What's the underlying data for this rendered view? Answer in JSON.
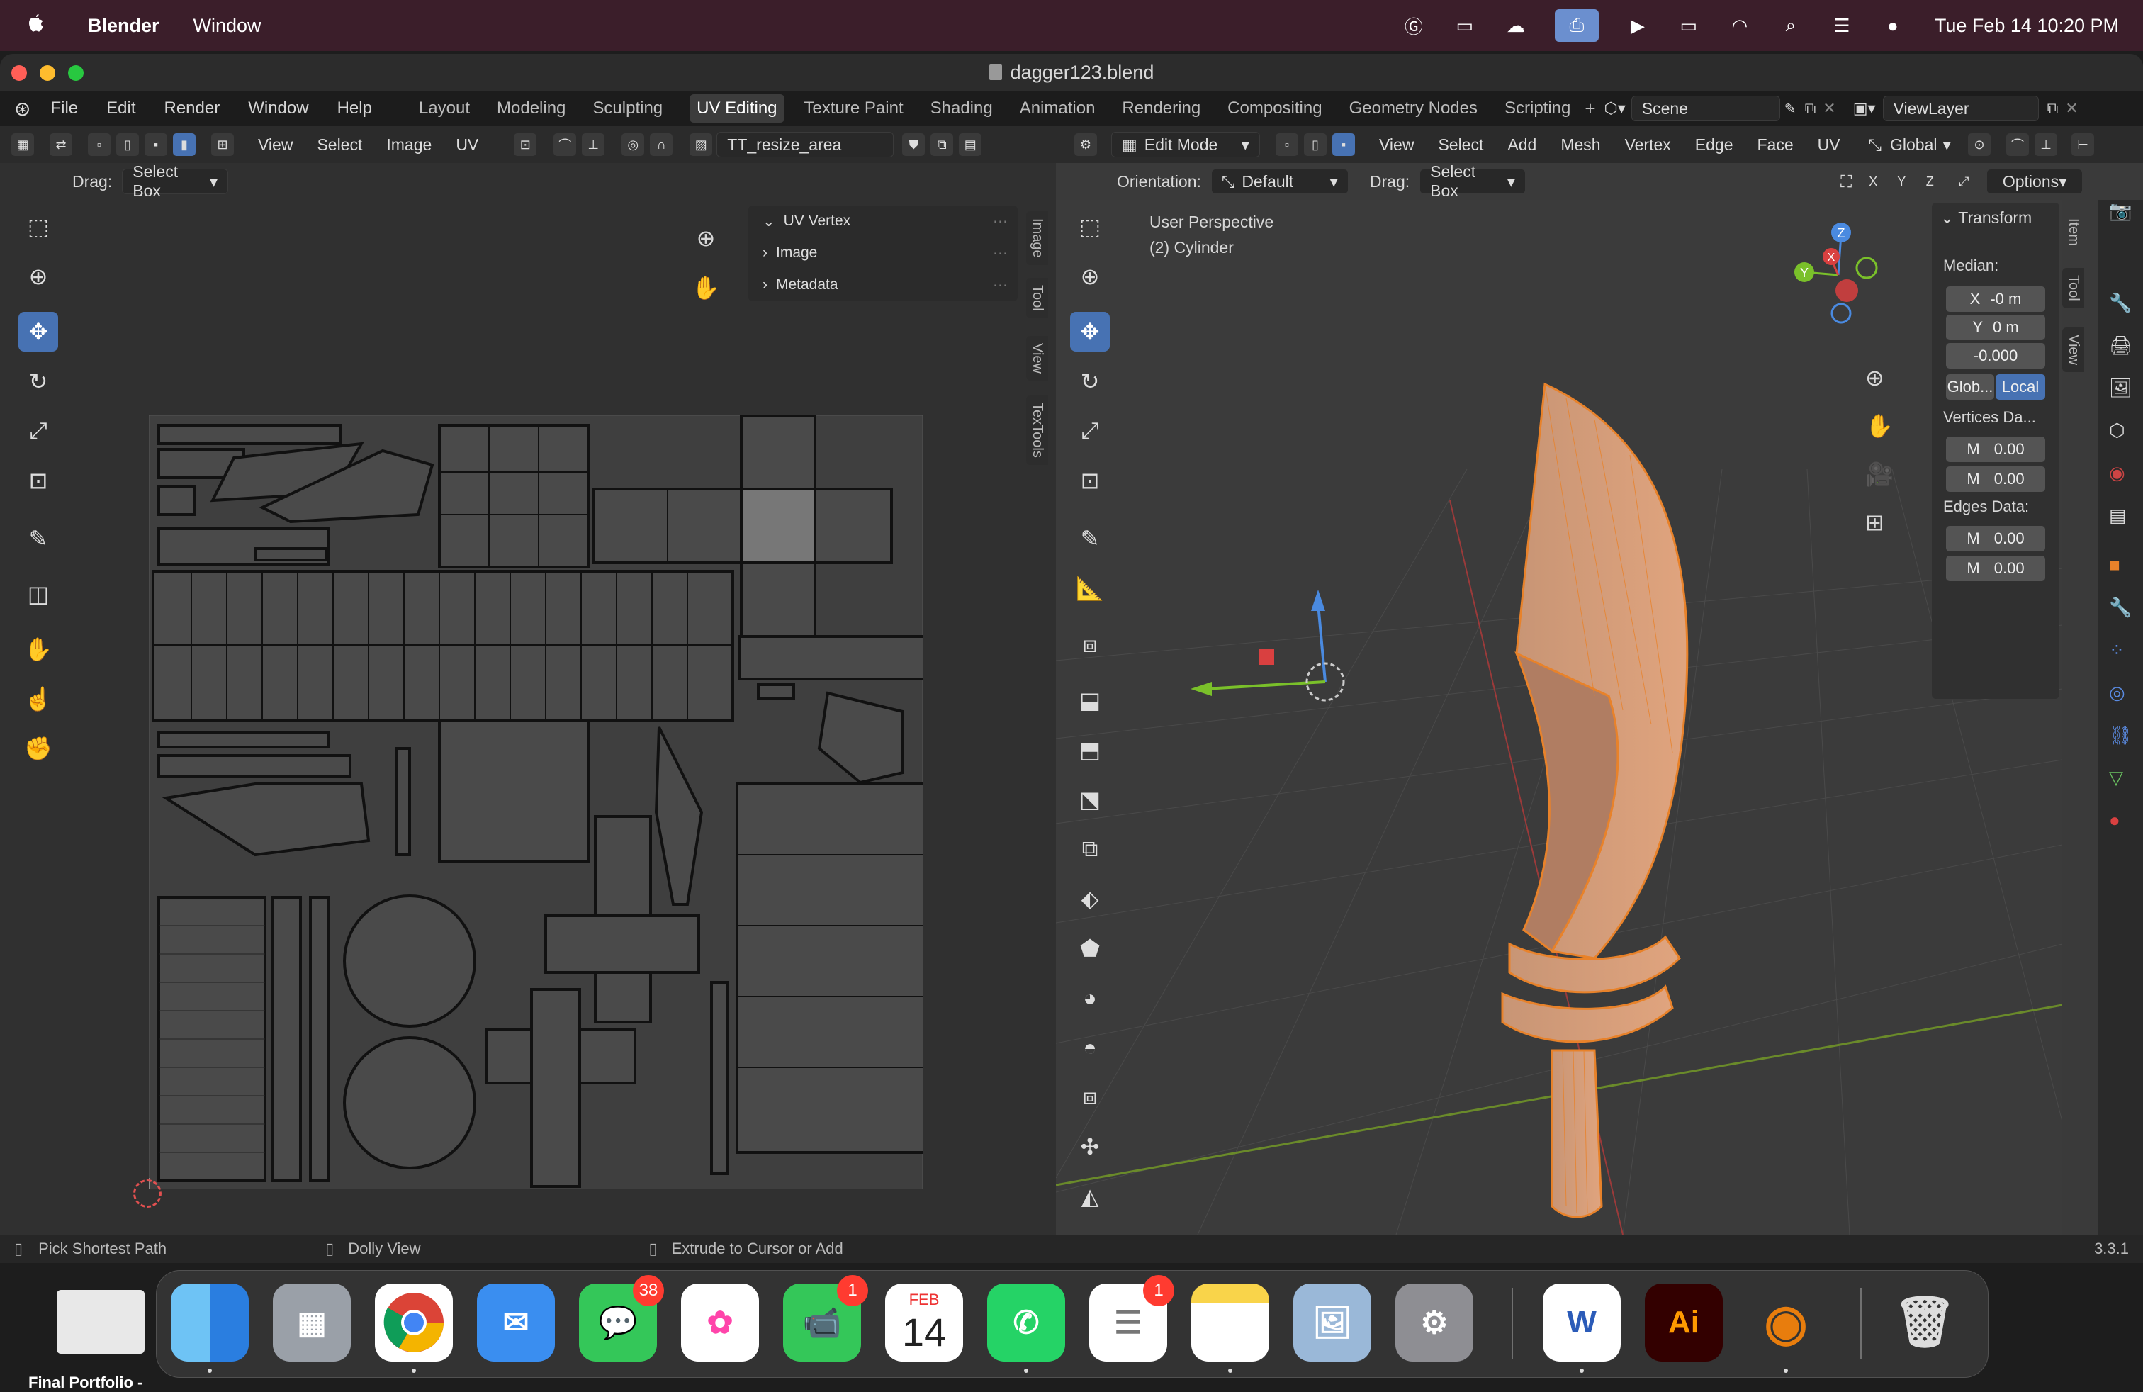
{
  "menubar": {
    "app_name": "Blender",
    "items": [
      "Window"
    ],
    "clock": "Tue Feb 14  10:20 PM"
  },
  "window": {
    "title": "dagger123.blend"
  },
  "blender_menu": {
    "items": [
      "File",
      "Edit",
      "Render",
      "Window",
      "Help"
    ],
    "workspaces": [
      "Layout",
      "Modeling",
      "Sculpting",
      "UV Editing",
      "Texture Paint",
      "Shading",
      "Animation",
      "Rendering",
      "Compositing",
      "Geometry Nodes",
      "Scripting"
    ],
    "active_workspace": "UV Editing",
    "scene": "Scene",
    "view_layer": "ViewLayer"
  },
  "uv_editor": {
    "menus": [
      "View",
      "Select",
      "Image",
      "UV"
    ],
    "image_name": "TT_resize_area",
    "drag_label": "Drag:",
    "drag_value": "Select Box",
    "panels": [
      {
        "label": "UV Vertex",
        "expanded": true
      },
      {
        "label": "Image",
        "expanded": false
      },
      {
        "label": "Metadata",
        "expanded": false
      }
    ],
    "side_tabs": [
      "Image",
      "Tool",
      "View",
      "TexTools"
    ]
  },
  "viewport": {
    "mode": "Edit Mode",
    "menus": [
      "View",
      "Select",
      "Add",
      "Mesh",
      "Vertex",
      "Edge",
      "Face",
      "UV"
    ],
    "transform_orientation": "Global",
    "orientation_label": "Orientation:",
    "orientation_value": "Default",
    "drag_label": "Drag:",
    "drag_value": "Select Box",
    "axes": [
      "X",
      "Y",
      "Z"
    ],
    "options": "Options",
    "perspective": "User Perspective",
    "object": "(2) Cylinder",
    "side_tabs": [
      "Item",
      "Tool",
      "View"
    ],
    "transform": {
      "title": "Transform",
      "median_label": "Median:",
      "x_label": "X",
      "x": "-0 m",
      "y_label": "Y",
      "y": "0 m",
      "z": "-0.000",
      "global_btn": "Glob...",
      "local_btn": "Local",
      "vertices_label": "Vertices Da...",
      "v1_label": "M",
      "v1": "0.00",
      "v2_label": "M",
      "v2": "0.00",
      "edges_label": "Edges Data:",
      "e1_label": "M",
      "e1": "0.00",
      "e2_label": "M",
      "e2": "0.00"
    },
    "gizmo": {
      "x": "X",
      "y": "Y",
      "z": "Z"
    }
  },
  "statusbar": {
    "left": "Pick Shortest Path",
    "mid": "Dolly View",
    "right_action": "Extrude to Cursor or Add",
    "version": "3.3.1"
  },
  "dock": {
    "calendar_month": "FEB",
    "calendar_day": "14",
    "messages_badge": "38",
    "facetime_badge": "1",
    "reminders_badge": "1",
    "word_label": "W",
    "illustrator_label": "Ai",
    "folder_caption": "Final Portfolio -"
  },
  "colors": {
    "accent": "#4772b3",
    "selection": "#e8822a",
    "menubar": "#3b1e2a"
  }
}
